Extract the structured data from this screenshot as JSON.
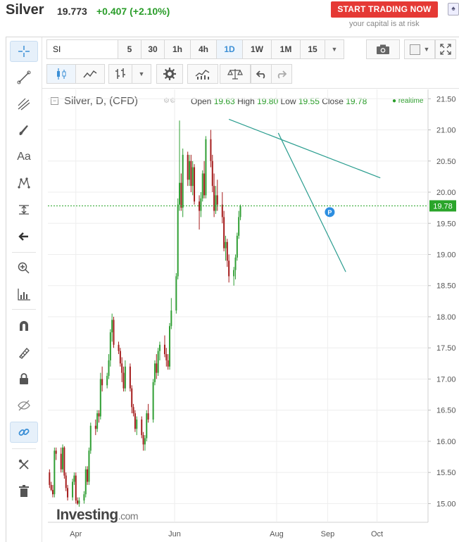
{
  "header": {
    "instrument": "Silver",
    "price": "19.773",
    "change": "+0.407 (+2.10%)",
    "trade_button": "START TRADING NOW",
    "risk_note": "your capital is at risk"
  },
  "toolbar": {
    "symbol": "SI",
    "intervals": [
      "5",
      "30",
      "1h",
      "4h",
      "1D",
      "1W",
      "1M",
      "15"
    ],
    "active_interval": "1D"
  },
  "legend": {
    "title": "Silver, D, (CFD)",
    "open_label": "Open",
    "open": "19.63",
    "high_label": "High",
    "high": "19.80",
    "low_label": "Low",
    "low": "19.55",
    "close_label": "Close",
    "close": "19.78",
    "realtime": "realtime"
  },
  "logo": {
    "main": "Investing",
    "suffix": ".com"
  },
  "icons": {
    "left_toolbar": [
      "crosshair-icon",
      "trend-line-icon",
      "pitchfork-icon",
      "brush-icon",
      "text-icon",
      "pattern-icon",
      "measure-icon",
      "arrow-left-icon",
      "zoom-icon",
      "volume-profile-icon",
      "magnet-icon",
      "stay-in-drawing-icon",
      "lock-icon",
      "hide-icon",
      "link-icon",
      "remove-tools-icon",
      "trash-icon"
    ],
    "top_toolbar": [
      "candles-icon",
      "line-chart-icon",
      "bar-chart-icon",
      "settings-gear-icon",
      "indicators-icon",
      "compare-icon",
      "undo-icon",
      "redo-icon",
      "camera-icon",
      "color-square-icon",
      "fullscreen-icon"
    ]
  },
  "colors": {
    "up": "#2f9e33",
    "down": "#a51c1c",
    "trend": "#2a9d8f",
    "price_line": "#2aa52a",
    "accent": "#3b8fd6"
  },
  "chart_data": {
    "type": "candlestick",
    "title": "Silver, D, (CFD)",
    "x_labels": [
      "Apr",
      "Jun",
      "Aug",
      "Sep",
      "Oct"
    ],
    "x_label_days": [
      1,
      61,
      123,
      154,
      184
    ],
    "y_ticks": [
      15.0,
      15.5,
      16.0,
      16.5,
      17.0,
      17.5,
      18.0,
      18.5,
      19.0,
      19.5,
      20.0,
      20.5,
      21.0,
      21.5
    ],
    "y_tick_labels": [
      "15.00",
      "15.50",
      "16.00",
      "16.50",
      "17.00",
      "17.50",
      "18.00",
      "18.50",
      "19.00",
      "19.50",
      "20.00",
      "20.50",
      "21.00",
      "21.50"
    ],
    "ylim": [
      14.7,
      21.65
    ],
    "xlim": [
      -16,
      215
    ],
    "current_price": 19.78,
    "current_price_label": "19.78",
    "current_marker": "P",
    "trendlines": [
      {
        "from": [
          94,
          21.17
        ],
        "to": [
          186,
          20.23
        ]
      },
      {
        "from": [
          124,
          20.95
        ],
        "to": [
          165,
          18.72
        ]
      }
    ],
    "dates": [
      -15,
      -14,
      -13,
      -12,
      -11,
      -8,
      -7,
      -6,
      -5,
      -4,
      -1,
      0,
      1,
      2,
      3,
      6,
      7,
      8,
      9,
      10,
      13,
      14,
      15,
      16,
      17,
      20,
      21,
      22,
      23,
      24,
      27,
      28,
      29,
      30,
      31,
      34,
      35,
      36,
      37,
      38,
      41,
      42,
      43,
      44,
      45,
      48,
      49,
      50,
      51,
      52,
      55,
      56,
      57,
      58,
      59,
      62,
      63,
      64,
      65,
      66,
      69,
      70,
      71,
      72,
      73,
      76,
      77,
      78,
      79,
      80,
      83,
      84,
      85,
      86,
      87,
      90,
      91,
      92,
      93,
      94,
      97,
      98,
      99,
      100,
      101,
      104,
      105,
      106,
      107,
      108,
      111,
      112,
      113,
      114,
      115,
      118,
      119,
      120,
      121,
      122,
      125,
      126,
      127,
      128,
      129,
      132,
      133,
      134,
      135,
      136,
      139,
      140,
      141,
      142,
      143,
      146,
      147,
      148,
      149,
      150,
      153,
      154,
      155,
      156,
      157
    ],
    "ohlc": [
      [
        15.5,
        15.55,
        15.25,
        15.3
      ],
      [
        15.3,
        15.35,
        15.2,
        15.22
      ],
      [
        15.22,
        15.3,
        15.1,
        15.15
      ],
      [
        15.15,
        15.9,
        15.1,
        15.85
      ],
      [
        15.85,
        15.9,
        15.7,
        15.8
      ],
      [
        15.8,
        15.9,
        15.5,
        15.55
      ],
      [
        15.55,
        15.95,
        15.5,
        15.9
      ],
      [
        15.9,
        15.92,
        15.4,
        15.45
      ],
      [
        15.45,
        15.5,
        15.2,
        15.25
      ],
      [
        15.25,
        15.3,
        15.05,
        15.1
      ],
      [
        15.1,
        15.4,
        15.05,
        15.35
      ],
      [
        15.35,
        15.5,
        15.3,
        15.45
      ],
      [
        15.45,
        15.5,
        15.0,
        15.05
      ],
      [
        15.05,
        15.1,
        14.98,
        15.0
      ],
      [
        15.0,
        15.1,
        14.95,
        15.05
      ],
      [
        15.05,
        15.2,
        15.0,
        15.15
      ],
      [
        15.15,
        15.6,
        15.1,
        15.55
      ],
      [
        15.55,
        15.6,
        15.3,
        15.35
      ],
      [
        15.35,
        15.9,
        15.3,
        15.85
      ],
      [
        15.85,
        16.3,
        15.8,
        16.25
      ],
      [
        16.25,
        16.35,
        16.1,
        16.2
      ],
      [
        16.2,
        16.5,
        16.15,
        16.45
      ],
      [
        16.45,
        16.5,
        16.3,
        16.4
      ],
      [
        16.4,
        17.1,
        16.35,
        17.0
      ],
      [
        17.0,
        17.2,
        16.8,
        16.9
      ],
      [
        16.9,
        17.1,
        16.85,
        17.05
      ],
      [
        17.05,
        17.4,
        17.0,
        17.3
      ],
      [
        17.3,
        17.8,
        17.2,
        17.75
      ],
      [
        17.75,
        18.05,
        17.6,
        17.95
      ],
      [
        17.95,
        18.0,
        17.5,
        17.55
      ],
      [
        17.55,
        17.6,
        17.4,
        17.45
      ],
      [
        17.45,
        17.5,
        17.2,
        17.25
      ],
      [
        17.25,
        17.35,
        16.95,
        17.1
      ],
      [
        17.1,
        17.2,
        16.8,
        16.85
      ],
      [
        16.85,
        17.3,
        16.8,
        17.2
      ],
      [
        17.2,
        17.25,
        16.8,
        16.85
      ],
      [
        16.85,
        16.9,
        16.45,
        16.55
      ],
      [
        16.55,
        16.6,
        16.4,
        16.45
      ],
      [
        16.45,
        16.5,
        16.15,
        16.2
      ],
      [
        16.2,
        16.4,
        16.1,
        16.35
      ],
      [
        16.35,
        16.4,
        16.05,
        16.1
      ],
      [
        16.1,
        16.15,
        15.85,
        15.95
      ],
      [
        15.95,
        16.1,
        15.85,
        16.05
      ],
      [
        16.05,
        16.5,
        16.0,
        16.45
      ],
      [
        16.45,
        16.6,
        16.3,
        16.35
      ],
      [
        16.35,
        17.0,
        16.3,
        16.95
      ],
      [
        16.95,
        17.3,
        16.9,
        17.25
      ],
      [
        17.25,
        17.4,
        17.0,
        17.1
      ],
      [
        17.1,
        17.5,
        17.05,
        17.45
      ],
      [
        17.45,
        17.6,
        17.3,
        17.55
      ],
      [
        17.55,
        17.7,
        17.35,
        17.4
      ],
      [
        17.4,
        17.5,
        17.2,
        17.3
      ],
      [
        17.3,
        17.4,
        17.15,
        17.2
      ],
      [
        17.2,
        17.9,
        17.15,
        17.85
      ],
      [
        17.85,
        18.3,
        17.8,
        18.1
      ],
      [
        18.1,
        18.7,
        18.05,
        18.65
      ],
      [
        18.65,
        19.9,
        18.6,
        19.8
      ],
      [
        19.8,
        21.15,
        19.7,
        20.15
      ],
      [
        20.15,
        20.3,
        19.7,
        19.75
      ],
      [
        19.75,
        20.7,
        19.6,
        20.6
      ],
      [
        20.6,
        20.65,
        20.1,
        20.2
      ],
      [
        20.2,
        20.6,
        20.1,
        20.5
      ],
      [
        20.5,
        20.6,
        20.0,
        20.1
      ],
      [
        20.1,
        20.5,
        19.95,
        20.4
      ],
      [
        20.4,
        20.45,
        19.8,
        19.85
      ],
      [
        19.85,
        19.95,
        19.4,
        19.7
      ],
      [
        19.7,
        20.0,
        19.6,
        19.9
      ],
      [
        19.9,
        20.35,
        19.85,
        20.3
      ],
      [
        20.3,
        20.5,
        19.9,
        19.95
      ],
      [
        19.95,
        20.9,
        19.9,
        20.85
      ],
      [
        20.85,
        21.0,
        20.4,
        20.5
      ],
      [
        20.5,
        20.6,
        20.0,
        20.1
      ],
      [
        20.1,
        20.3,
        19.6,
        19.7
      ],
      [
        19.7,
        20.1,
        19.65,
        19.95
      ],
      [
        19.95,
        20.2,
        19.7,
        19.8
      ],
      [
        19.8,
        20.0,
        19.5,
        19.6
      ],
      [
        19.6,
        19.7,
        19.05,
        19.1
      ],
      [
        19.1,
        19.3,
        18.9,
        19.2
      ],
      [
        19.2,
        19.25,
        18.8,
        18.9
      ],
      [
        18.9,
        19.0,
        18.55,
        18.65
      ],
      [
        18.65,
        18.8,
        18.5,
        18.75
      ],
      [
        18.75,
        19.0,
        18.6,
        18.95
      ],
      [
        18.95,
        19.35,
        18.9,
        19.3
      ],
      [
        19.3,
        19.7,
        19.25,
        19.6
      ],
      [
        19.6,
        19.8,
        19.55,
        19.78
      ]
    ]
  }
}
